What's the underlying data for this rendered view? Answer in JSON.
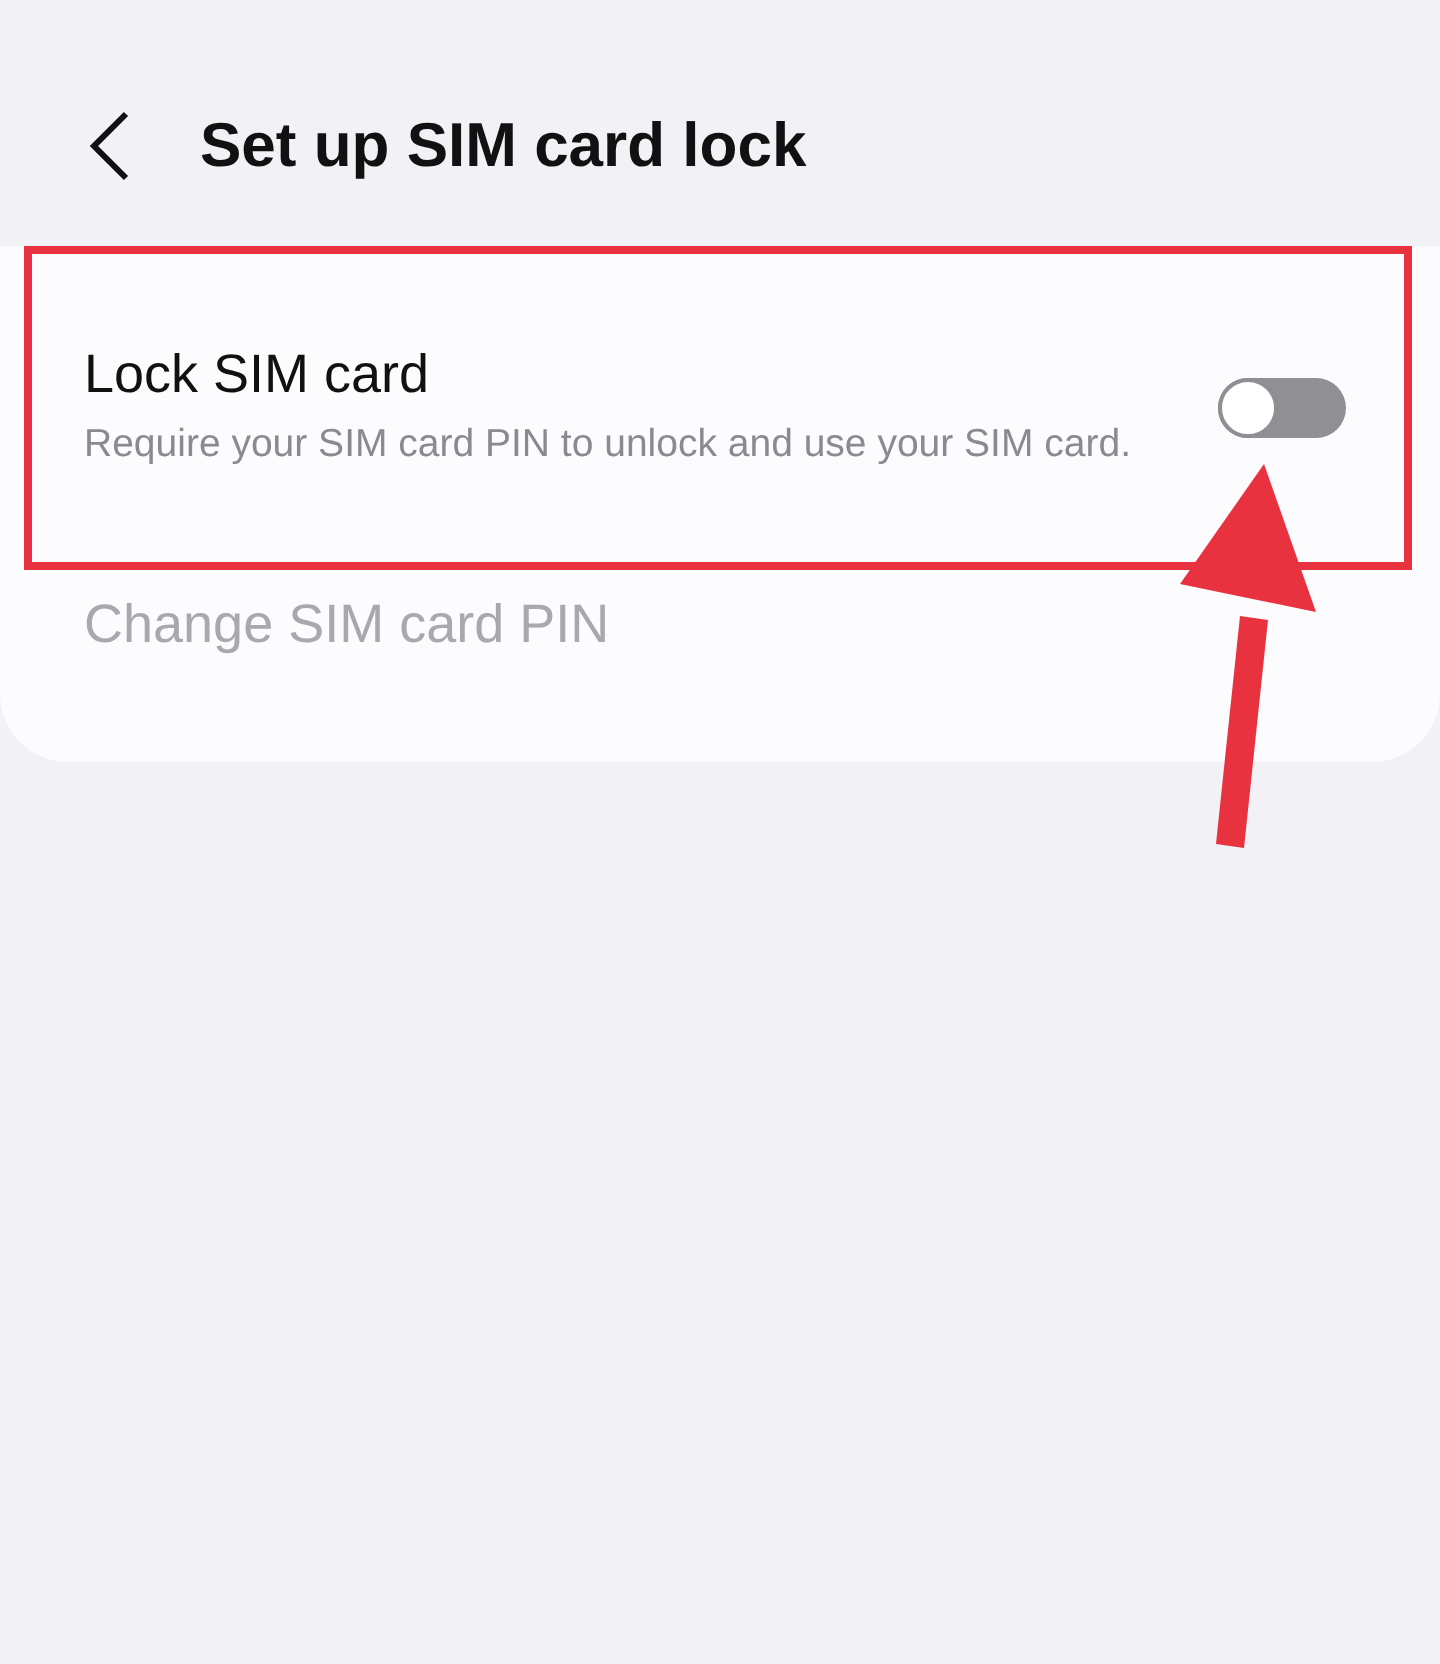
{
  "header": {
    "title": "Set up SIM card lock"
  },
  "settings": [
    {
      "kind": "toggle",
      "title": "Lock SIM card",
      "description": "Require your SIM card PIN to unlock and use your SIM card.",
      "on": false,
      "highlighted": true,
      "disabled": false
    },
    {
      "kind": "link",
      "title": "Change SIM card PIN",
      "disabled": true,
      "highlighted": false
    }
  ]
}
